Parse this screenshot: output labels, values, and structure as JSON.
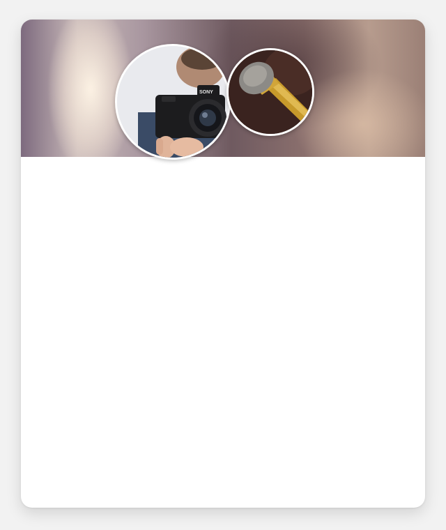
{
  "profile": {
    "cover_image": "blurred-bokeh-cover-photo",
    "avatars": [
      {
        "icon": "camera-photographer-photo"
      },
      {
        "icon": "microphone-photo"
      }
    ],
    "camera_brand_text": "SONY"
  },
  "colors": {
    "card_background": "#ffffff",
    "page_background": "#f2f2f2",
    "avatar_border": "#ffffff"
  }
}
